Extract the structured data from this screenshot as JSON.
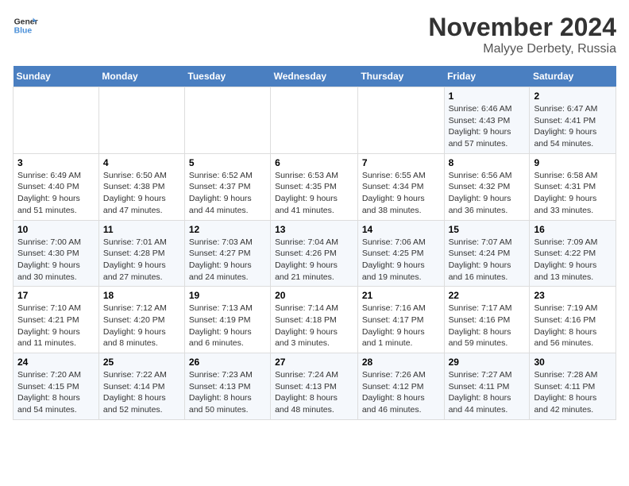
{
  "logo": {
    "line1": "General",
    "line2": "Blue"
  },
  "title": "November 2024",
  "subtitle": "Malyye Derbety, Russia",
  "days_of_week": [
    "Sunday",
    "Monday",
    "Tuesday",
    "Wednesday",
    "Thursday",
    "Friday",
    "Saturday"
  ],
  "weeks": [
    [
      {
        "day": "",
        "detail": ""
      },
      {
        "day": "",
        "detail": ""
      },
      {
        "day": "",
        "detail": ""
      },
      {
        "day": "",
        "detail": ""
      },
      {
        "day": "",
        "detail": ""
      },
      {
        "day": "1",
        "detail": "Sunrise: 6:46 AM\nSunset: 4:43 PM\nDaylight: 9 hours and 57 minutes."
      },
      {
        "day": "2",
        "detail": "Sunrise: 6:47 AM\nSunset: 4:41 PM\nDaylight: 9 hours and 54 minutes."
      }
    ],
    [
      {
        "day": "3",
        "detail": "Sunrise: 6:49 AM\nSunset: 4:40 PM\nDaylight: 9 hours and 51 minutes."
      },
      {
        "day": "4",
        "detail": "Sunrise: 6:50 AM\nSunset: 4:38 PM\nDaylight: 9 hours and 47 minutes."
      },
      {
        "day": "5",
        "detail": "Sunrise: 6:52 AM\nSunset: 4:37 PM\nDaylight: 9 hours and 44 minutes."
      },
      {
        "day": "6",
        "detail": "Sunrise: 6:53 AM\nSunset: 4:35 PM\nDaylight: 9 hours and 41 minutes."
      },
      {
        "day": "7",
        "detail": "Sunrise: 6:55 AM\nSunset: 4:34 PM\nDaylight: 9 hours and 38 minutes."
      },
      {
        "day": "8",
        "detail": "Sunrise: 6:56 AM\nSunset: 4:32 PM\nDaylight: 9 hours and 36 minutes."
      },
      {
        "day": "9",
        "detail": "Sunrise: 6:58 AM\nSunset: 4:31 PM\nDaylight: 9 hours and 33 minutes."
      }
    ],
    [
      {
        "day": "10",
        "detail": "Sunrise: 7:00 AM\nSunset: 4:30 PM\nDaylight: 9 hours and 30 minutes."
      },
      {
        "day": "11",
        "detail": "Sunrise: 7:01 AM\nSunset: 4:28 PM\nDaylight: 9 hours and 27 minutes."
      },
      {
        "day": "12",
        "detail": "Sunrise: 7:03 AM\nSunset: 4:27 PM\nDaylight: 9 hours and 24 minutes."
      },
      {
        "day": "13",
        "detail": "Sunrise: 7:04 AM\nSunset: 4:26 PM\nDaylight: 9 hours and 21 minutes."
      },
      {
        "day": "14",
        "detail": "Sunrise: 7:06 AM\nSunset: 4:25 PM\nDaylight: 9 hours and 19 minutes."
      },
      {
        "day": "15",
        "detail": "Sunrise: 7:07 AM\nSunset: 4:24 PM\nDaylight: 9 hours and 16 minutes."
      },
      {
        "day": "16",
        "detail": "Sunrise: 7:09 AM\nSunset: 4:22 PM\nDaylight: 9 hours and 13 minutes."
      }
    ],
    [
      {
        "day": "17",
        "detail": "Sunrise: 7:10 AM\nSunset: 4:21 PM\nDaylight: 9 hours and 11 minutes."
      },
      {
        "day": "18",
        "detail": "Sunrise: 7:12 AM\nSunset: 4:20 PM\nDaylight: 9 hours and 8 minutes."
      },
      {
        "day": "19",
        "detail": "Sunrise: 7:13 AM\nSunset: 4:19 PM\nDaylight: 9 hours and 6 minutes."
      },
      {
        "day": "20",
        "detail": "Sunrise: 7:14 AM\nSunset: 4:18 PM\nDaylight: 9 hours and 3 minutes."
      },
      {
        "day": "21",
        "detail": "Sunrise: 7:16 AM\nSunset: 4:17 PM\nDaylight: 9 hours and 1 minute."
      },
      {
        "day": "22",
        "detail": "Sunrise: 7:17 AM\nSunset: 4:16 PM\nDaylight: 8 hours and 59 minutes."
      },
      {
        "day": "23",
        "detail": "Sunrise: 7:19 AM\nSunset: 4:16 PM\nDaylight: 8 hours and 56 minutes."
      }
    ],
    [
      {
        "day": "24",
        "detail": "Sunrise: 7:20 AM\nSunset: 4:15 PM\nDaylight: 8 hours and 54 minutes."
      },
      {
        "day": "25",
        "detail": "Sunrise: 7:22 AM\nSunset: 4:14 PM\nDaylight: 8 hours and 52 minutes."
      },
      {
        "day": "26",
        "detail": "Sunrise: 7:23 AM\nSunset: 4:13 PM\nDaylight: 8 hours and 50 minutes."
      },
      {
        "day": "27",
        "detail": "Sunrise: 7:24 AM\nSunset: 4:13 PM\nDaylight: 8 hours and 48 minutes."
      },
      {
        "day": "28",
        "detail": "Sunrise: 7:26 AM\nSunset: 4:12 PM\nDaylight: 8 hours and 46 minutes."
      },
      {
        "day": "29",
        "detail": "Sunrise: 7:27 AM\nSunset: 4:11 PM\nDaylight: 8 hours and 44 minutes."
      },
      {
        "day": "30",
        "detail": "Sunrise: 7:28 AM\nSunset: 4:11 PM\nDaylight: 8 hours and 42 minutes."
      }
    ]
  ]
}
